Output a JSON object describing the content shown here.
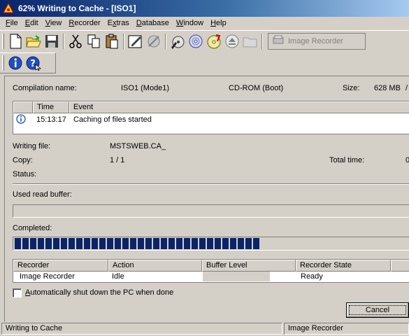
{
  "window": {
    "title": "62% Writing to Cache - [ISO1]"
  },
  "menu": [
    "File",
    "Edit",
    "View",
    "Recorder",
    "Extras",
    "Database",
    "Window",
    "Help"
  ],
  "menu_underline": [
    "F",
    "E",
    "V",
    "R",
    "x",
    "D",
    "W",
    "H"
  ],
  "toolbar": {
    "recorder_select": "Image Recorder",
    "icons": [
      "new-document-icon",
      "open-folder-icon",
      "save-icon",
      "cut-icon",
      "copy-icon",
      "paste-icon",
      "properties-icon",
      "erase-icon",
      "burn-icon",
      "disc-icon",
      "disc-info-icon",
      "eject-icon",
      "browse-folder-icon",
      "recorder-icon",
      "info-icon",
      "help-icon"
    ]
  },
  "compilation": {
    "name_label": "Compilation name:",
    "name_value": "ISO1 (Mode1)",
    "type_value": "CD-ROM (Boot)",
    "size_label": "Size:",
    "size_value": "628 MB",
    "size_suffix": "/"
  },
  "log": {
    "columns": [
      "Time",
      "Event"
    ],
    "rows": [
      {
        "time": "15:13:17",
        "event": "Caching of files started"
      }
    ]
  },
  "progress": {
    "writing_file_label": "Writing file:",
    "writing_file_value": "MSTSWEB.CA_",
    "copy_label": "Copy:",
    "copy_value": "1 / 1",
    "total_time_label": "Total time:",
    "total_time_value": "0",
    "status_label": "Status:",
    "used_buffer_label": "Used read buffer:",
    "used_buffer_percent": 0,
    "completed_label": "Completed:",
    "completed_percent": 62
  },
  "recorders": {
    "columns": [
      "Recorder",
      "Action",
      "Buffer Level",
      "Recorder State"
    ],
    "rows": [
      {
        "recorder": "Image Recorder",
        "action": "Idle",
        "buffer": "",
        "state": "Ready"
      }
    ]
  },
  "options": {
    "shutdown_label": "Automatically shut down the PC when done",
    "shutdown_checked": false
  },
  "buttons": {
    "cancel": "Cancel"
  },
  "statusbar": {
    "left": "Writing to Cache",
    "right": "Image Recorder"
  },
  "colors": {
    "title_start": "#0a246a",
    "progress_block": "#0a246a",
    "face": "#d4d0c8"
  }
}
